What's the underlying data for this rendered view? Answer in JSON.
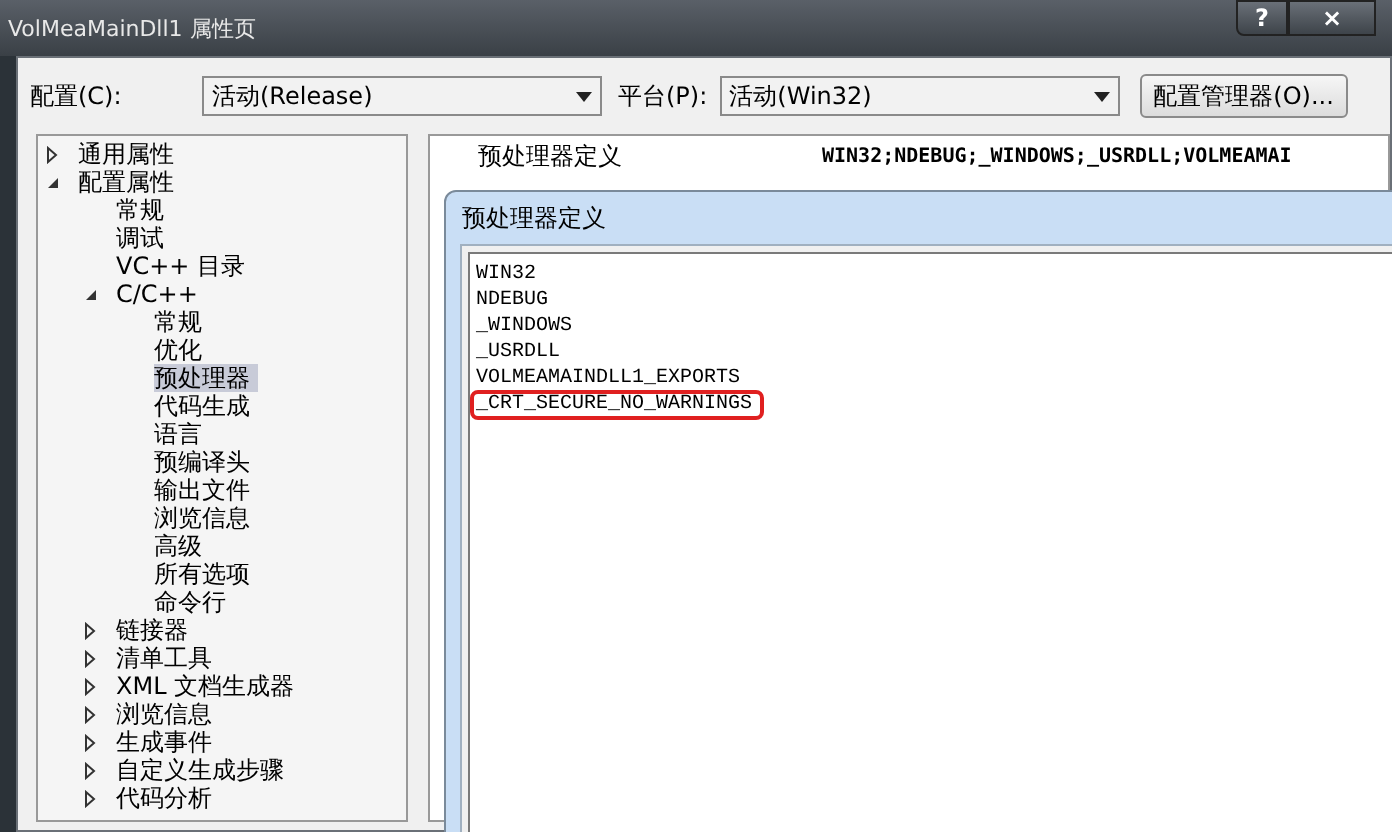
{
  "window": {
    "title": "VolMeaMainDll1 属性页",
    "buttons": [
      "?",
      "×"
    ]
  },
  "config": {
    "label": "配置(C):",
    "value": "活动(Release)"
  },
  "platform": {
    "label": "平台(P):",
    "value": "活动(Win32)"
  },
  "config_manager_button": "配置管理器(O)...",
  "tree": [
    {
      "label": "通用属性",
      "expanded": false,
      "selected": false
    },
    {
      "label": "配置属性",
      "expanded": true,
      "selected": false,
      "children": [
        {
          "label": "常规",
          "selected": false
        },
        {
          "label": "调试",
          "selected": false
        },
        {
          "label": "VC++ 目录",
          "selected": false
        },
        {
          "label": "C/C++",
          "expanded": true,
          "selected": false,
          "children": [
            {
              "label": "常规",
              "selected": false
            },
            {
              "label": "优化",
              "selected": false
            },
            {
              "label": "预处理器",
              "selected": true
            },
            {
              "label": "代码生成",
              "selected": false
            },
            {
              "label": "语言",
              "selected": false
            },
            {
              "label": "预编译头",
              "selected": false
            },
            {
              "label": "输出文件",
              "selected": false
            },
            {
              "label": "浏览信息",
              "selected": false
            },
            {
              "label": "高级",
              "selected": false
            },
            {
              "label": "所有选项",
              "selected": false
            },
            {
              "label": "命令行",
              "selected": false
            }
          ]
        },
        {
          "label": "链接器",
          "expanded": false,
          "selected": false
        },
        {
          "label": "清单工具",
          "expanded": false,
          "selected": false
        },
        {
          "label": "XML 文档生成器",
          "expanded": false,
          "selected": false
        },
        {
          "label": "浏览信息",
          "expanded": false,
          "selected": false
        },
        {
          "label": "生成事件",
          "expanded": false,
          "selected": false
        },
        {
          "label": "自定义生成步骤",
          "expanded": false,
          "selected": false
        },
        {
          "label": "代码分析",
          "expanded": false,
          "selected": false
        }
      ]
    }
  ],
  "properties": [
    {
      "name": "预处理器定义",
      "value": "WIN32;NDEBUG;_WINDOWS;_USRDLL;VOLMEAMAI"
    }
  ],
  "editor_dialog": {
    "title": "预处理器定义",
    "lines": [
      {
        "text": "WIN32",
        "highlighted": false
      },
      {
        "text": "NDEBUG",
        "highlighted": false
      },
      {
        "text": "_WINDOWS",
        "highlighted": false
      },
      {
        "text": "_USRDLL",
        "highlighted": false
      },
      {
        "text": "VOLMEAMAINDLL1_EXPORTS",
        "highlighted": false
      },
      {
        "text": "_CRT_SECURE_NO_WARNINGS",
        "highlighted": true
      }
    ]
  }
}
